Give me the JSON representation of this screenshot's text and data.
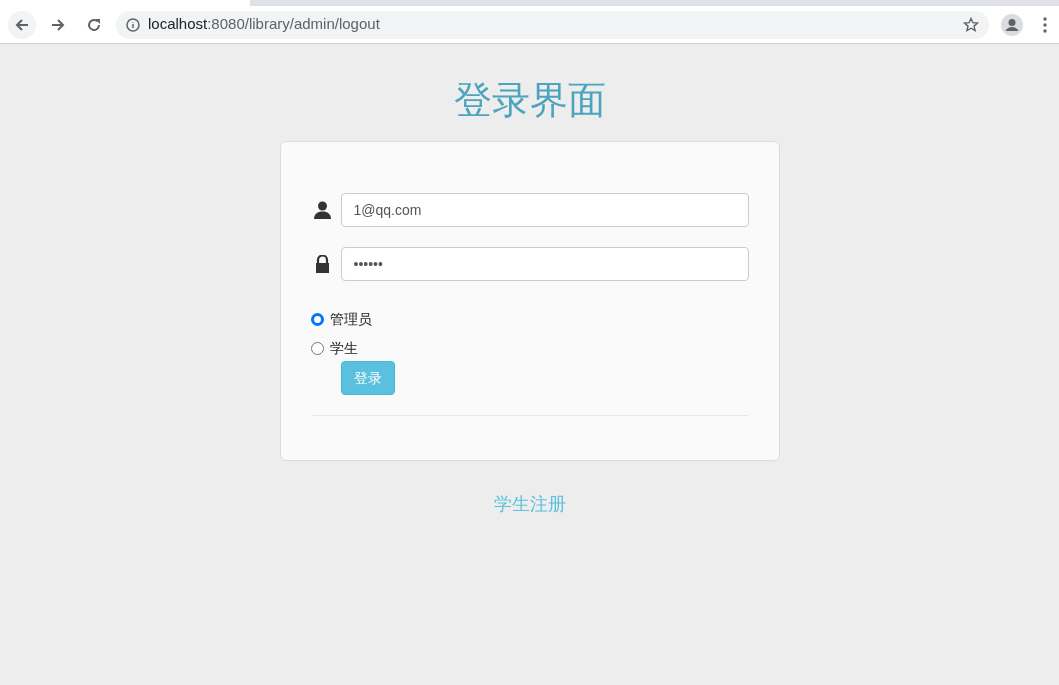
{
  "browser": {
    "url_host": "localhost",
    "url_path": ":8080/library/admin/logout"
  },
  "page": {
    "title": "登录界面"
  },
  "form": {
    "username": {
      "value": "1@qq.com"
    },
    "password": {
      "value": "••••••"
    },
    "roles": [
      {
        "label": "管理员",
        "selected": true
      },
      {
        "label": "学生",
        "selected": false
      }
    ],
    "submit": "登录"
  },
  "register_link": "学生注册"
}
